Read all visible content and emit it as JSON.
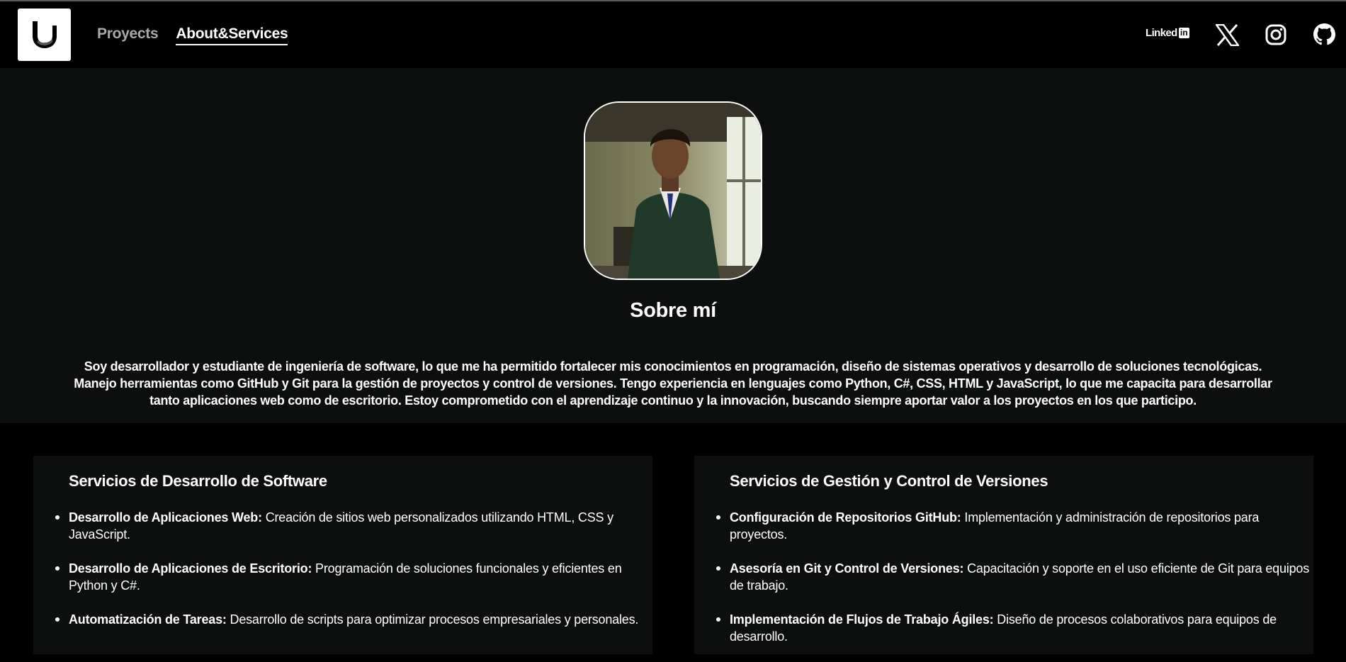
{
  "header": {
    "logo_letter": "U",
    "nav": [
      {
        "label": "Proyects",
        "active": false
      },
      {
        "label": "About&Services",
        "active": true
      }
    ],
    "socials": {
      "linkedin_text": "Linked",
      "linkedin_box": "in",
      "icons": [
        "linkedin-icon",
        "x-icon",
        "instagram-icon",
        "github-icon"
      ]
    }
  },
  "about": {
    "title": "Sobre mí",
    "text": "Soy desarrollador y estudiante de ingeniería de software, lo que me ha permitido fortalecer mis conocimientos en programación, diseño de sistemas operativos y desarrollo de soluciones tecnológicas. Manejo herramientas como GitHub y Git para la gestión de proyectos y control de versiones. Tengo experiencia en lenguajes como Python, C#, CSS, HTML y JavaScript, lo que me capacita para desarrollar tanto aplicaciones web como de escritorio. Estoy comprometido con el aprendizaje continuo y la innovación, buscando siempre aportar valor a los proyectos en los que participo."
  },
  "services": [
    {
      "title": "Servicios de Desarrollo de Software",
      "items": [
        {
          "name": "Desarrollo de Aplicaciones Web:",
          "desc": " Creación de sitios web personalizados utilizando HTML, CSS y JavaScript."
        },
        {
          "name": "Desarrollo de Aplicaciones de Escritorio:",
          "desc": " Programación de soluciones funcionales y eficientes en Python y C#."
        },
        {
          "name": "Automatización de Tareas:",
          "desc": " Desarrollo de scripts para optimizar procesos empresariales y personales."
        }
      ]
    },
    {
      "title": "Servicios de Gestión y Control de Versiones",
      "items": [
        {
          "name": "Configuración de Repositorios GitHub:",
          "desc": " Implementación y administración de repositorios para proyectos."
        },
        {
          "name": "Asesoría en Git y Control de Versiones:",
          "desc": " Capacitación y soporte en el uso eficiente de Git para equipos de trabajo."
        },
        {
          "name": "Implementación de Flujos de Trabajo Ágiles:",
          "desc": " Diseño de procesos colaborativos para equipos de desarrollo."
        }
      ]
    }
  ]
}
